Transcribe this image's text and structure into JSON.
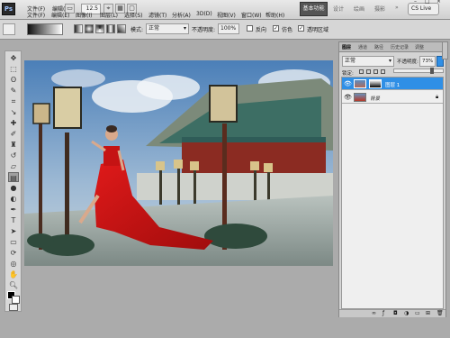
{
  "app": {
    "logo": "Ps",
    "menu": [
      "文件(F)",
      "编辑(E)",
      "图像(I)",
      "图层(L)",
      "选择(S)",
      "滤镜(T)",
      "分析(A)",
      "3D(D)",
      "视图(V)",
      "窗口(W)",
      "帮助(H)"
    ],
    "zoom": "12.5",
    "workspaces": [
      "基本功能",
      "设计",
      "绘画",
      "摄影"
    ],
    "workspace_more": "»",
    "cslive": "CS Live",
    "window_controls": [
      "–",
      "□",
      "×"
    ]
  },
  "options": {
    "mode_label": "模式:",
    "mode_value": "正常",
    "opacity_label": "不透明度:",
    "opacity_value": "100%",
    "reverse_label": "反向",
    "dither_label": "仿色",
    "transparency_label": "透明区域"
  },
  "layers_panel": {
    "tabs": [
      "图层",
      "通道",
      "路径",
      "历史记录",
      "调整"
    ],
    "blend_mode": "正常",
    "opacity_label": "不透明度:",
    "opacity_value": "73%",
    "lock_label": "锁定:",
    "layers": [
      {
        "name": "图层 1",
        "selected": true
      },
      {
        "name": "背景",
        "selected": false
      }
    ]
  },
  "colors": {
    "accent": "#2f8fe6",
    "menubar": "#d9d9d9",
    "panel": "#d4d4d4"
  }
}
